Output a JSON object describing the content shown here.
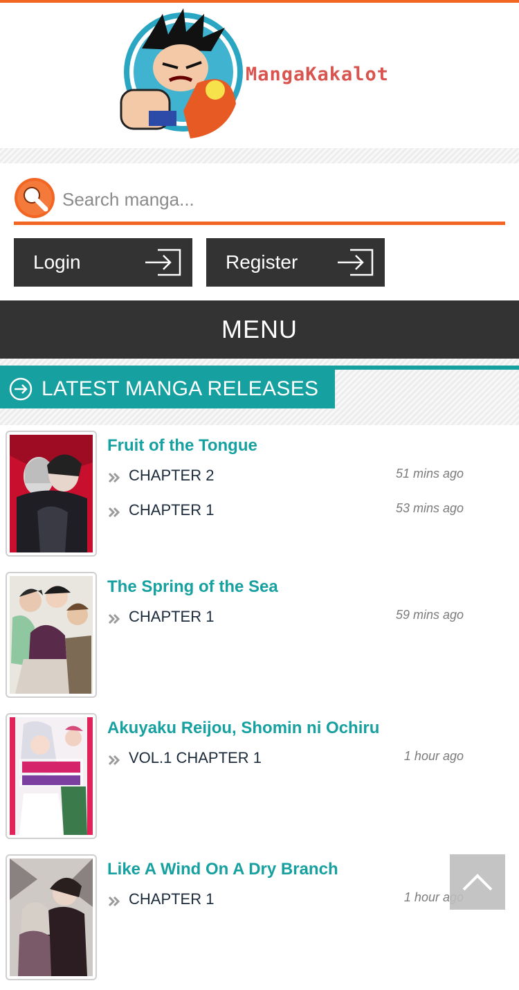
{
  "colors": {
    "accent": "#f26522",
    "teal": "#17a0a0",
    "dark": "#333333"
  },
  "brand": {
    "logo_text": "MangaKakalot",
    "logo_icon": "goku-fist-logo"
  },
  "search": {
    "placeholder": "Search manga...",
    "value": ""
  },
  "auth": {
    "login_label": "Login",
    "register_label": "Register"
  },
  "nav": {
    "menu_label": "MENU"
  },
  "section": {
    "title": "LATEST MANGA RELEASES"
  },
  "releases": [
    {
      "title": "Fruit of the Tongue",
      "chapters": [
        {
          "name": "CHAPTER 2",
          "time": "51 mins ago"
        },
        {
          "name": "CHAPTER 1",
          "time": "53 mins ago"
        }
      ]
    },
    {
      "title": "The Spring of the Sea",
      "chapters": [
        {
          "name": "CHAPTER 1",
          "time": "59 mins ago"
        }
      ]
    },
    {
      "title": "Akuyaku Reijou, Shomin ni Ochiru",
      "chapters": [
        {
          "name": "VOL.1 CHAPTER 1",
          "time": "1 hour ago"
        }
      ]
    },
    {
      "title": "Like A Wind On A Dry Branch",
      "chapters": [
        {
          "name": "CHAPTER 1",
          "time": "1 hour ago"
        }
      ]
    }
  ]
}
